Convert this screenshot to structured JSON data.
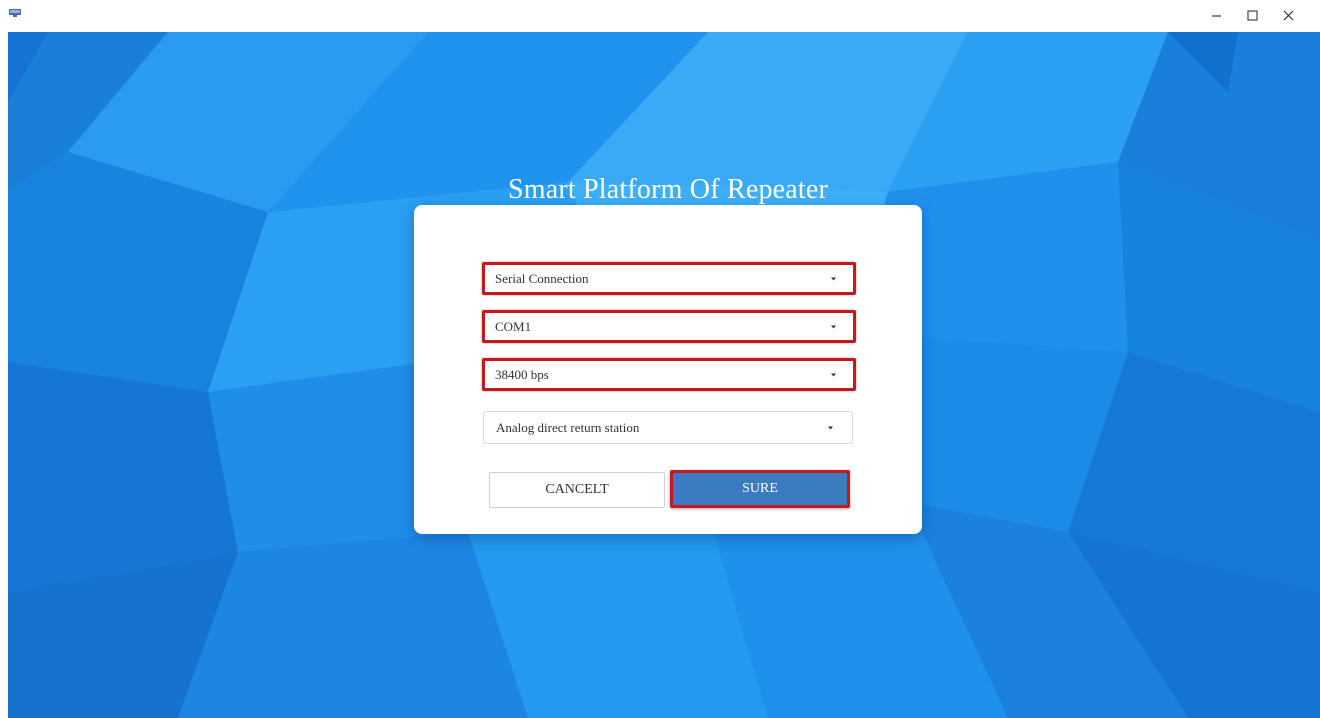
{
  "window": {
    "controls": {
      "minimize_icon": "minimize-icon",
      "maximize_icon": "maximize-icon",
      "close_icon": "close-icon"
    }
  },
  "app": {
    "title": "Smart Platform Of Repeater"
  },
  "form": {
    "connection_type": {
      "value": "Serial Connection",
      "highlighted": true
    },
    "port": {
      "value": "COM1",
      "highlighted": true
    },
    "baud_rate": {
      "value": "38400 bps",
      "highlighted": true
    },
    "station_type": {
      "value": "Analog direct return station",
      "highlighted": false
    },
    "cancel_label": "CANCELT",
    "sure_label": "SURE"
  },
  "colors": {
    "background": "#1e8fea",
    "highlight_border": "#c8181f",
    "primary_button": "#3b7bbf",
    "panel": "#ffffff"
  }
}
